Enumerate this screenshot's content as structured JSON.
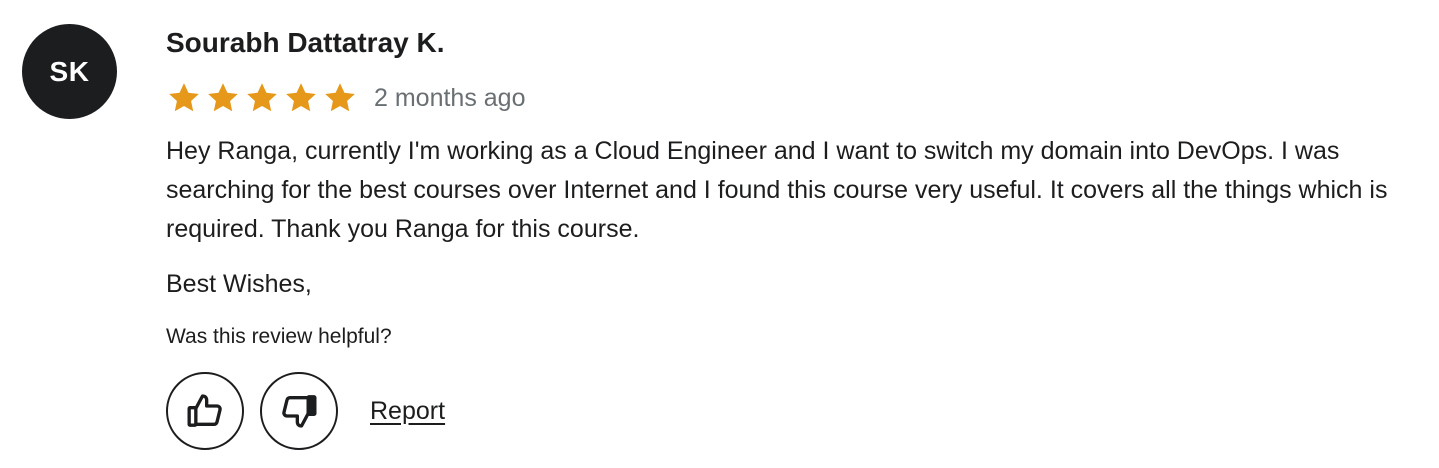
{
  "reviewer": {
    "initials": "SK",
    "name": "Sourabh Dattatray K."
  },
  "rating": {
    "stars": 5,
    "max": 5,
    "star_color": "#e59819",
    "time_ago": "2 months ago"
  },
  "review": {
    "body": "Hey Ranga, currently I'm working as a Cloud Engineer and I want to switch my domain into DevOps. I was searching for the best courses over Internet and I found this course very useful. It covers all the things which is required. Thank you Ranga for this course.",
    "signoff": "Best Wishes,"
  },
  "feedback": {
    "question": "Was this review helpful?",
    "thumbs_up_icon": "thumbs-up-icon",
    "thumbs_down_icon": "thumbs-down-icon",
    "report_label": "Report"
  }
}
